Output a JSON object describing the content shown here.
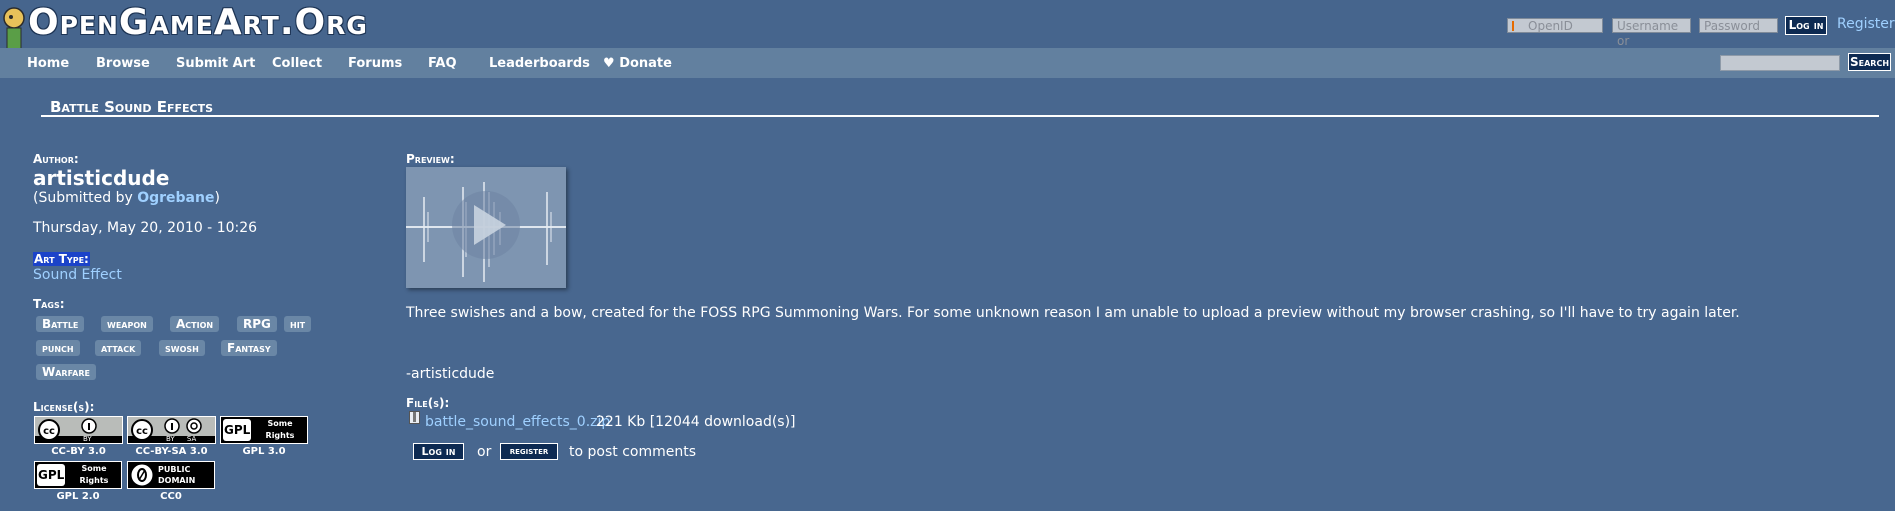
{
  "header": {
    "site_name": "OpenGameArt.Org",
    "openid_placeholder": "OpenID",
    "username_placeholder": "Username or",
    "password_placeholder": "Password",
    "login_label": "Log in",
    "register_label": "Register"
  },
  "nav": {
    "items": [
      "Home",
      "Browse",
      "Submit Art",
      "Collect",
      "Forums",
      "FAQ",
      "Leaderboards",
      "Donate"
    ],
    "donate_icon": "heart-icon",
    "search_label": "Search"
  },
  "page": {
    "title": "Battle Sound Effects"
  },
  "author": {
    "label": "Author:",
    "name": "artisticdude",
    "submitted_prefix": "(Submitted by ",
    "submitted_by": "Ogrebane",
    "submitted_suffix": ")",
    "date": "Thursday, May 20, 2010 - 10:26"
  },
  "art_type": {
    "label": "Art Type:",
    "value": "Sound Effect"
  },
  "tags": {
    "label": "Tags:",
    "items": [
      "Battle",
      "weapon",
      "Action",
      "RPG",
      "hit",
      "punch",
      "attack",
      "swosh",
      "Fantasy",
      "Warfare"
    ]
  },
  "licenses": {
    "label": "License(s):",
    "items": [
      {
        "caption": "CC-BY 3.0",
        "badge_text": "BY"
      },
      {
        "caption": "CC-BY-SA 3.0",
        "badge_text": "BY SA"
      },
      {
        "caption": "GPL 3.0",
        "badge_text": "Some Rights Reserved"
      },
      {
        "caption": "GPL 2.0",
        "badge_text": "Some Rights Reserved"
      },
      {
        "caption": "CC0",
        "badge_text": "PUBLIC DOMAIN"
      }
    ],
    "gpl_text": "GPL"
  },
  "preview": {
    "label": "Preview:",
    "play_icon": "play-icon"
  },
  "description": {
    "text": "Three swishes and a bow, created for the FOSS RPG Summoning Wars. For some unknown reason I am unable to upload a preview without my browser crashing, so I'll have to try again later.",
    "signature": "-artisticdude"
  },
  "files": {
    "label": "File(s):",
    "name": "battle_sound_effects_0.zip",
    "meta": "221 Kb [12044 download(s)]"
  },
  "comments": {
    "login_label": "Log in",
    "or_text": "or",
    "register_label": "register",
    "suffix": "to post comments"
  },
  "colors": {
    "background": "#48678f",
    "nav_background": "#62809f",
    "link": "#9fd0ff",
    "tag_background": "#6a87a6",
    "highlight": "#1c43c9"
  }
}
